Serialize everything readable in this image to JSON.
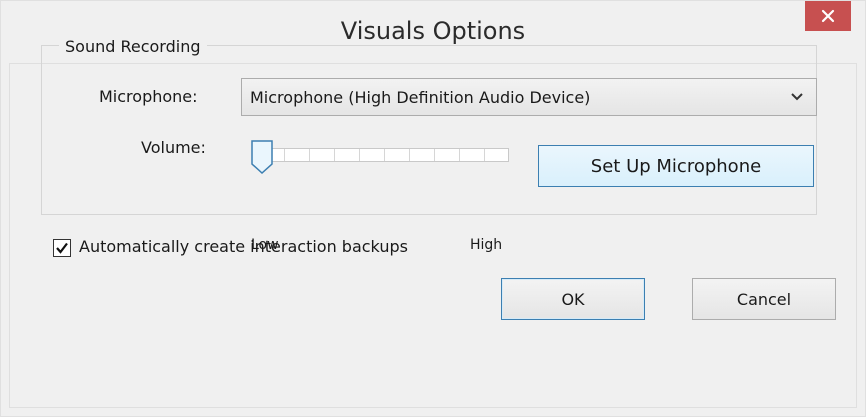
{
  "window": {
    "title": "Visuals Options",
    "close_icon": "close-icon"
  },
  "sound_recording": {
    "group_label": "Sound Recording",
    "microphone_label": "Microphone:",
    "microphone_value": "Microphone (High Definition Audio Device)",
    "volume_label": "Volume:",
    "volume_low_label": "Low",
    "volume_high_label": "High",
    "volume_level": 0,
    "setup_button_label": "Set Up Microphone"
  },
  "backups": {
    "checkbox_label": "Automatically create interaction backups",
    "checked": true
  },
  "buttons": {
    "ok_label": "OK",
    "cancel_label": "Cancel"
  },
  "colors": {
    "close_button": "#c75050",
    "accent_border": "#3c7fb1"
  }
}
